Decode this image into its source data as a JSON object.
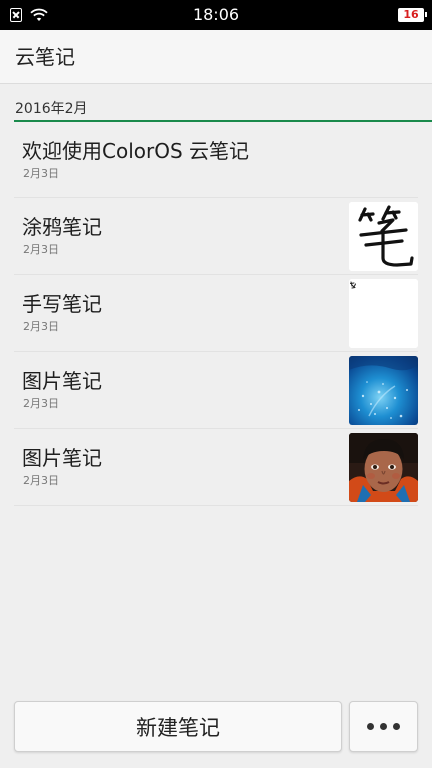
{
  "status_bar": {
    "time": "18:06",
    "battery_level": "16",
    "icons": [
      "sim-icon",
      "wifi-icon",
      "battery-icon"
    ],
    "battery_color": "#d81f1f"
  },
  "header": {
    "title": "云笔记"
  },
  "section": {
    "label": "2016年2月",
    "accent_color": "#1a8a4c"
  },
  "notes": [
    {
      "title": "欢迎使用ColorOS 云笔记",
      "date": "2月3日",
      "thumbnail": null
    },
    {
      "title": "涂鸦笔记",
      "date": "2月3日",
      "thumbnail": "doodle-thumbnail"
    },
    {
      "title": "手写笔记",
      "date": "2月3日",
      "thumbnail": "handwriting-thumbnail"
    },
    {
      "title": "图片笔记",
      "date": "2月3日",
      "thumbnail": "water-photo-thumbnail"
    },
    {
      "title": "图片笔记",
      "date": "2月3日",
      "thumbnail": "portrait-photo-thumbnail"
    }
  ],
  "toolbar": {
    "new_note_label": "新建笔记",
    "more_icon": "more-dots-icon"
  }
}
